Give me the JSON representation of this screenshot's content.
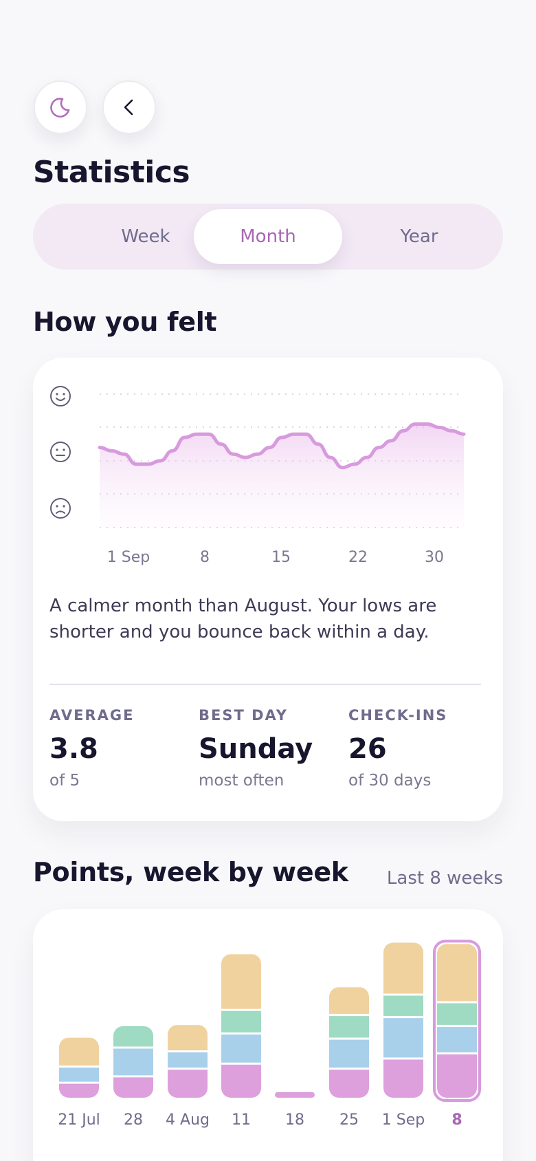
{
  "header": {
    "theme_icon": "moon-icon",
    "back_icon": "chevron-left-icon",
    "title": "Statistics"
  },
  "tabs": [
    {
      "label": "Week",
      "active": false
    },
    {
      "label": "Month",
      "active": true
    },
    {
      "label": "Year",
      "active": false
    }
  ],
  "mood": {
    "heading": "How you felt",
    "faces": [
      "smile-face-icon",
      "neutral-face-icon",
      "sad-face-icon"
    ],
    "summary": "A calmer month than August. Your lows are shorter and you bounce back within a day.",
    "stats": [
      {
        "label": "AVERAGE",
        "value": "3.8",
        "sub": "of 5"
      },
      {
        "label": "BEST DAY",
        "value": "Sunday",
        "sub": "most often"
      },
      {
        "label": "CHECK-INS",
        "value": "26",
        "sub": "of 30 days"
      }
    ]
  },
  "points": {
    "heading": "Points, week by week",
    "range_label": "Last 8 weeks"
  },
  "colors": {
    "accent": "#a867b3",
    "mood_line": "#d89ade",
    "seg_pink": "#dda0dc",
    "seg_blue": "#a9d0eb",
    "seg_green": "#9fdbc3",
    "seg_orange": "#f0d29e"
  },
  "chart_data": [
    {
      "type": "area",
      "x_ticks": [
        "1 Sep",
        "8",
        "15",
        "22",
        "30"
      ],
      "y_scale": [
        "sad",
        "neutral",
        "happy"
      ],
      "ylim": [
        1,
        5
      ],
      "grid": true,
      "x": [
        1,
        2,
        3,
        4,
        5,
        6,
        7,
        8,
        9,
        10,
        11,
        12,
        13,
        14,
        15,
        16,
        17,
        18,
        19,
        20,
        21,
        22,
        23,
        24,
        25,
        26,
        27,
        28,
        29,
        30,
        31
      ],
      "values": [
        3.4,
        3.3,
        3.2,
        2.9,
        2.9,
        3.0,
        3.3,
        3.7,
        3.8,
        3.8,
        3.5,
        3.2,
        3.1,
        3.2,
        3.4,
        3.7,
        3.8,
        3.8,
        3.5,
        3.1,
        2.8,
        2.9,
        3.1,
        3.4,
        3.6,
        3.9,
        4.1,
        4.1,
        4.0,
        3.9,
        3.8
      ]
    },
    {
      "type": "bar",
      "stacked": true,
      "categories": [
        "21 Jul",
        "28",
        "4 Aug",
        "11",
        "18",
        "25",
        "1 Sep",
        "8"
      ],
      "highlighted": "8",
      "ylim": [
        0,
        240
      ],
      "series": [
        {
          "color": "pink",
          "values": [
            22,
            32,
            44,
            52,
            9,
            44,
            60,
            68
          ]
        },
        {
          "color": "blue",
          "values": [
            22,
            42,
            24,
            44,
            0,
            44,
            62,
            40
          ]
        },
        {
          "color": "green",
          "values": [
            0,
            32,
            0,
            34,
            0,
            34,
            32,
            34
          ]
        },
        {
          "color": "orange",
          "values": [
            44,
            0,
            40,
            86,
            0,
            42,
            80,
            90
          ]
        }
      ]
    }
  ]
}
